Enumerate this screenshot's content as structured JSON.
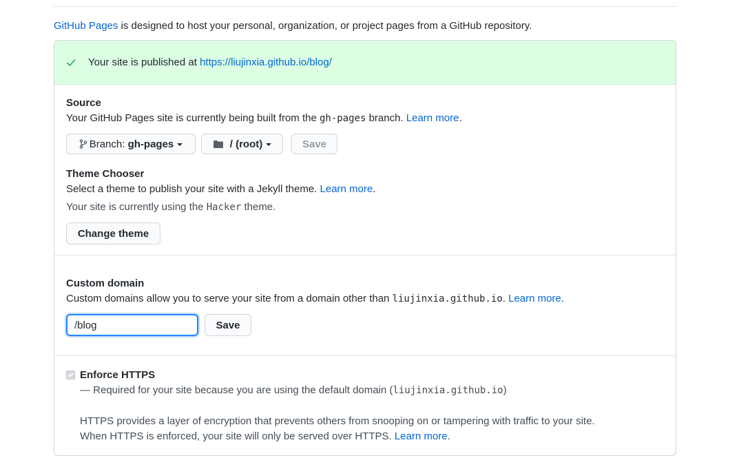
{
  "intro": {
    "link": "GitHub Pages",
    "text": " is designed to host your personal, organization, or project pages from a GitHub repository."
  },
  "flash": {
    "icon": "check-icon",
    "text": "Your site is published at ",
    "url": "https://liujinxia.github.io/blog/"
  },
  "source": {
    "title": "Source",
    "desc_prefix": "Your GitHub Pages site is currently being built from the ",
    "branch_code": "gh-pages",
    "desc_suffix": " branch. ",
    "learn_more": "Learn more",
    "period": ".",
    "branch_button_prefix": "Branch: ",
    "branch_button_value": "gh-pages",
    "folder_button": "/ (root)",
    "save": "Save"
  },
  "theme": {
    "title": "Theme Chooser",
    "desc": "Select a theme to publish your site with a Jekyll theme. ",
    "learn_more": "Learn more",
    "period": ".",
    "current_prefix": "Your site is currently using the ",
    "current_theme": "Hacker",
    "current_suffix": " theme.",
    "change_button": "Change theme"
  },
  "custom_domain": {
    "title": "Custom domain",
    "desc": "Custom domains allow you to serve your site from a domain other than ",
    "domain_code": "liujinxia.github.io",
    "period_space": ". ",
    "learn_more": "Learn more",
    "period": ".",
    "input_value": "/blog",
    "save": "Save"
  },
  "https": {
    "title": "Enforce HTTPS",
    "checked": true,
    "required_prefix": "— Required for your site because you are using the default domain (",
    "required_domain": "liujinxia.github.io",
    "required_suffix": ")",
    "line1": "HTTPS provides a layer of encryption that prevents others from snooping on or tampering with traffic to your site.",
    "line2": "When HTTPS is enforced, your site will only be served over HTTPS. ",
    "learn_more": "Learn more",
    "period": "."
  },
  "colors": {
    "link": "#0366d6",
    "flash_bg": "#dcffe4",
    "check": "#28a745"
  }
}
